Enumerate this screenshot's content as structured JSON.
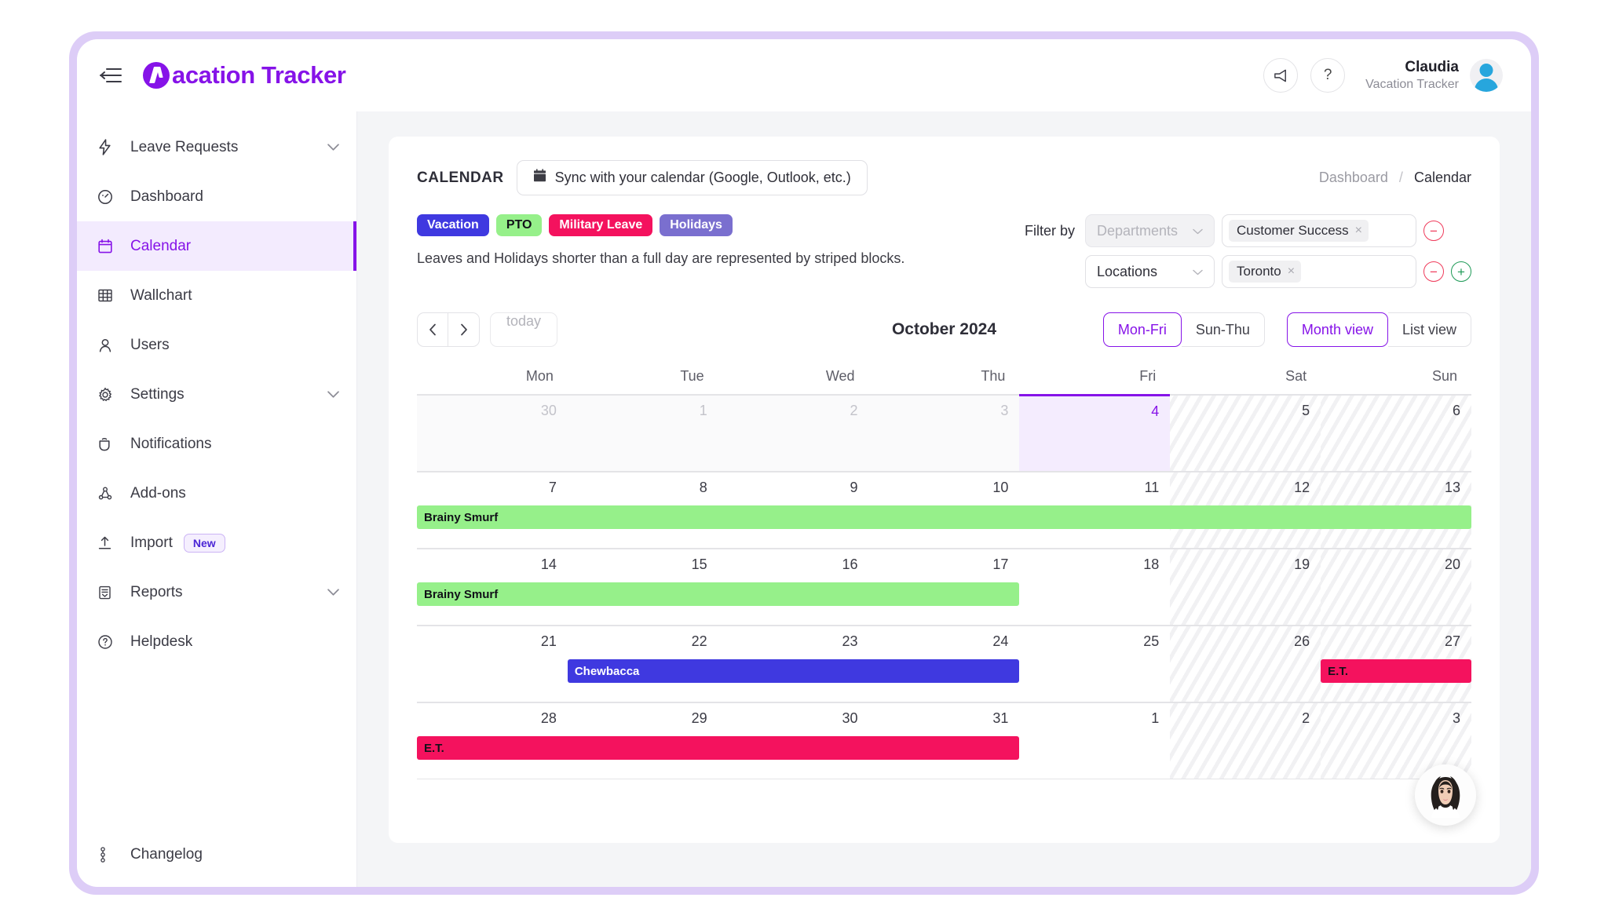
{
  "app": {
    "brand_initial": "V",
    "brand_name": "acation Tracker"
  },
  "topbar": {
    "menu_icon": "hamburger-collapse-icon",
    "announce_icon": "megaphone-icon",
    "help_icon": "question-mark-icon",
    "user_name": "Claudia",
    "user_org": "Vacation Tracker"
  },
  "sidebar": {
    "items": [
      {
        "label": "Leave Requests",
        "icon": "lightning-icon",
        "expandable": true,
        "active": false
      },
      {
        "label": "Dashboard",
        "icon": "gauge-icon",
        "expandable": false,
        "active": false
      },
      {
        "label": "Calendar",
        "icon": "calendar-icon",
        "expandable": false,
        "active": true
      },
      {
        "label": "Wallchart",
        "icon": "table-grid-icon",
        "expandable": false,
        "active": false
      },
      {
        "label": "Users",
        "icon": "person-icon",
        "expandable": false,
        "active": false
      },
      {
        "label": "Settings",
        "icon": "gear-icon",
        "expandable": true,
        "active": false
      },
      {
        "label": "Notifications",
        "icon": "bell-icon",
        "expandable": false,
        "active": false
      },
      {
        "label": "Add-ons",
        "icon": "puzzle-nodes-icon",
        "expandable": false,
        "active": false
      },
      {
        "label": "Import",
        "icon": "upload-icon",
        "expandable": false,
        "active": false,
        "badge": "New"
      },
      {
        "label": "Reports",
        "icon": "report-doc-icon",
        "expandable": true,
        "active": false
      },
      {
        "label": "Helpdesk",
        "icon": "question-circle-icon",
        "expandable": false,
        "active": false
      }
    ],
    "bottom_item": {
      "label": "Changelog",
      "icon": "changelog-icon"
    }
  },
  "page": {
    "title": "CALENDAR",
    "sync_button": "Sync with your calendar (Google, Outlook, etc.)",
    "sync_icon": "calendar-icon",
    "breadcrumb": {
      "parent": "Dashboard",
      "separator": "/",
      "current": "Calendar"
    }
  },
  "legend": {
    "chips": [
      {
        "label": "Vacation",
        "color": "#3f39e0",
        "text": "#ffffff"
      },
      {
        "label": "PTO",
        "color": "#96f08a",
        "text": "#111118"
      },
      {
        "label": "Military Leave",
        "color": "#f4125e",
        "text": "#ffffff"
      },
      {
        "label": "Holidays",
        "color": "#7a6fcf",
        "text": "#ffffff"
      }
    ],
    "note": "Leaves and Holidays shorter than a full day are represented by striped blocks."
  },
  "filters": {
    "label": "Filter by",
    "rows": [
      {
        "select_value": "Departments",
        "select_disabled": true,
        "tag": "Customer Success",
        "remove_icon": "minus-circle-icon",
        "add_icon": null
      },
      {
        "select_value": "Locations",
        "select_disabled": false,
        "tag": "Toronto",
        "remove_icon": "minus-circle-icon",
        "add_icon": "plus-circle-icon"
      }
    ],
    "caret_icon": "chevron-down-icon",
    "tag_close_icon": "close-icon"
  },
  "toolbar": {
    "prev_icon": "chevron-left-icon",
    "next_icon": "chevron-right-icon",
    "today_label": "today",
    "month_label": "October 2024",
    "week_mode": {
      "options": [
        "Mon-Fri",
        "Sun-Thu"
      ],
      "selected": "Mon-Fri"
    },
    "view_mode": {
      "options": [
        "Month view",
        "List view"
      ],
      "selected": "Month view"
    }
  },
  "calendar": {
    "day_headers": [
      "Mon",
      "Tue",
      "Wed",
      "Thu",
      "Fri",
      "Sat",
      "Sun"
    ],
    "weekend_columns": [
      5,
      6
    ],
    "today": {
      "week": 0,
      "col": 4,
      "day": "4"
    },
    "weeks": [
      {
        "days": [
          {
            "n": "30",
            "other": true
          },
          {
            "n": "1",
            "other": true
          },
          {
            "n": "2",
            "other": true
          },
          {
            "n": "3",
            "other": true
          },
          {
            "n": "4",
            "other": false,
            "today": true
          },
          {
            "n": "5",
            "other": false
          },
          {
            "n": "6",
            "other": false
          }
        ],
        "events": []
      },
      {
        "days": [
          {
            "n": "7",
            "other": false
          },
          {
            "n": "8",
            "other": false
          },
          {
            "n": "9",
            "other": false
          },
          {
            "n": "10",
            "other": false
          },
          {
            "n": "11",
            "other": false
          },
          {
            "n": "12",
            "other": false
          },
          {
            "n": "13",
            "other": false
          }
        ],
        "events": [
          {
            "label": "Brainy Smurf",
            "start": 0,
            "span": 7,
            "color": "#96f08a",
            "text_dark": true
          }
        ]
      },
      {
        "days": [
          {
            "n": "14",
            "other": false
          },
          {
            "n": "15",
            "other": false
          },
          {
            "n": "16",
            "other": false
          },
          {
            "n": "17",
            "other": false
          },
          {
            "n": "18",
            "other": false
          },
          {
            "n": "19",
            "other": false
          },
          {
            "n": "20",
            "other": false
          }
        ],
        "events": [
          {
            "label": "Brainy Smurf",
            "start": 0,
            "span": 4,
            "color": "#96f08a",
            "text_dark": true
          }
        ]
      },
      {
        "days": [
          {
            "n": "21",
            "other": false
          },
          {
            "n": "22",
            "other": false
          },
          {
            "n": "23",
            "other": false
          },
          {
            "n": "24",
            "other": false
          },
          {
            "n": "25",
            "other": false
          },
          {
            "n": "26",
            "other": false
          },
          {
            "n": "27",
            "other": false
          }
        ],
        "events": [
          {
            "label": "Chewbacca",
            "start": 1,
            "span": 3,
            "color": "#3f39e0",
            "text_dark": false
          },
          {
            "label": "E.T.",
            "start": 6,
            "span": 1,
            "color": "#f4125e",
            "text_dark": true
          }
        ]
      },
      {
        "days": [
          {
            "n": "28",
            "other": false
          },
          {
            "n": "29",
            "other": false
          },
          {
            "n": "30",
            "other": false
          },
          {
            "n": "31",
            "other": false
          },
          {
            "n": "1",
            "other": false
          },
          {
            "n": "2",
            "other": false
          },
          {
            "n": "3",
            "other": false
          }
        ],
        "events": [
          {
            "label": "E.T.",
            "start": 0,
            "span": 4,
            "color": "#f4125e",
            "text_dark": true
          }
        ]
      }
    ]
  },
  "chat_widget": {
    "icon": "support-agent-avatar"
  },
  "colors": {
    "brand_purple": "#8613e8",
    "frame_purple": "#ddcdf7",
    "today_bg": "#f4ecfe",
    "active_nav_bg": "#f3ebfe"
  }
}
